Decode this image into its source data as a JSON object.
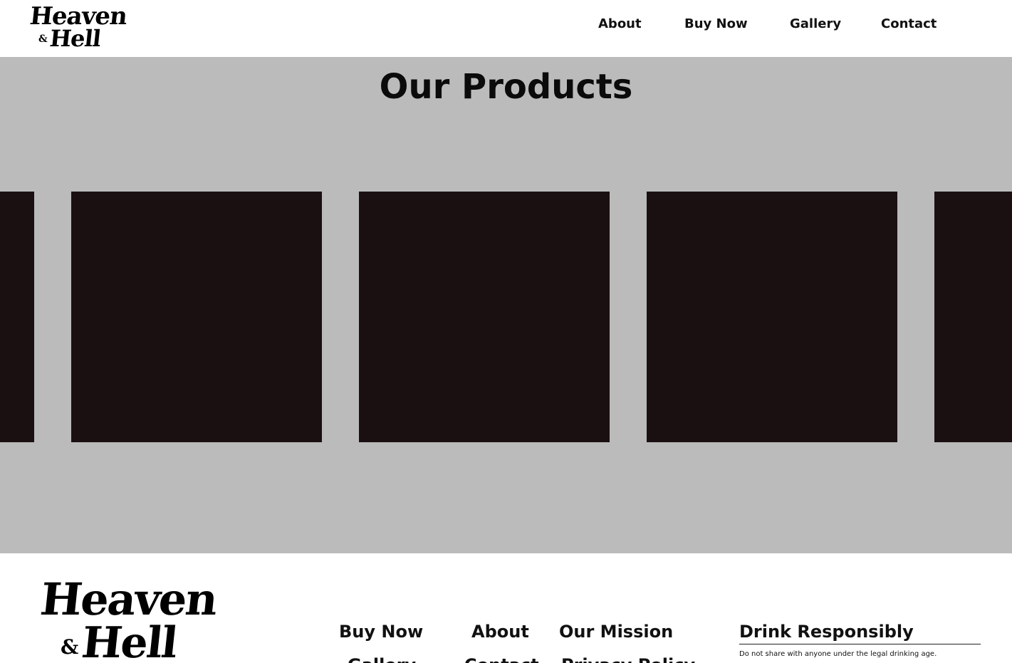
{
  "brand": {
    "logo_line1": "Heaven",
    "logo_amp": "&",
    "logo_line2": "Hell"
  },
  "header": {
    "nav": [
      {
        "label": "About"
      },
      {
        "label": "Buy Now"
      },
      {
        "label": "Gallery"
      },
      {
        "label": "Contact"
      }
    ]
  },
  "products": {
    "title": "Our Products",
    "card_color": "#1b1011",
    "background_color": "#bbbbbb"
  },
  "footer": {
    "links": [
      {
        "label": "Buy Now"
      },
      {
        "label": "About"
      },
      {
        "label": "Our Mission"
      },
      {
        "label": "Gallery"
      },
      {
        "label": "Contact"
      },
      {
        "label": "Privacy Policy"
      }
    ],
    "drink": {
      "title": "Drink Responsibly",
      "note": "Do not share with anyone under the legal drinking age."
    }
  }
}
